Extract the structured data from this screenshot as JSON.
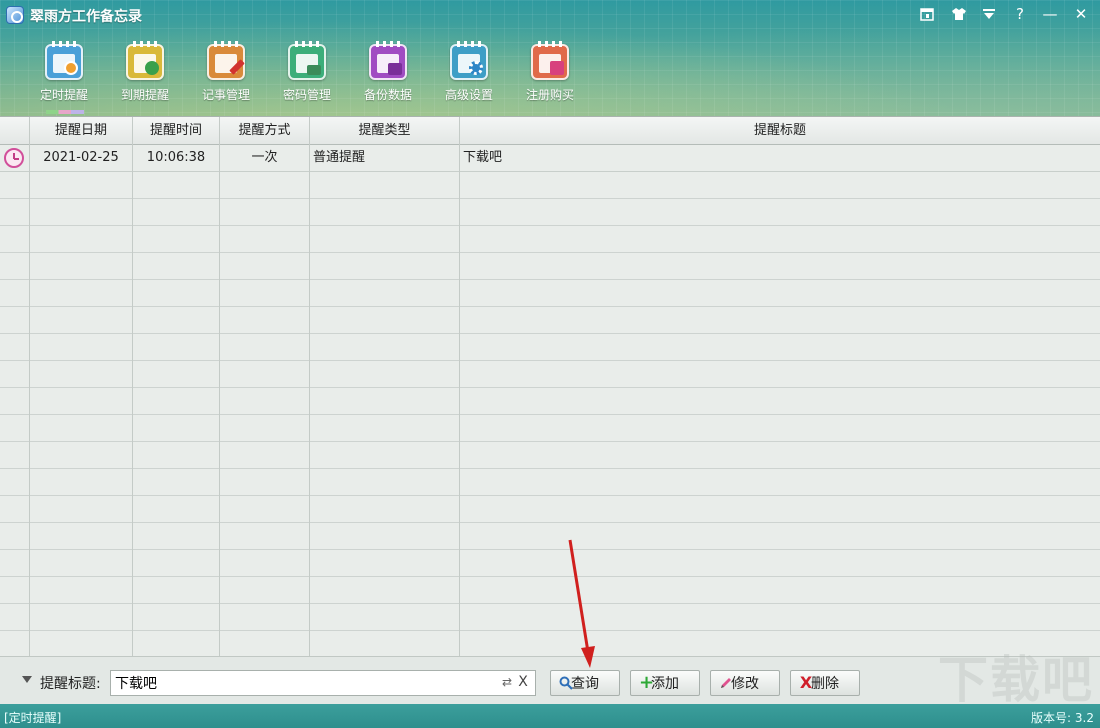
{
  "window": {
    "title": "翠雨方工作备忘录",
    "controls": [
      "calendar-icon",
      "skin-icon",
      "menu-icon",
      "help-icon",
      "minimize-icon",
      "close-icon"
    ],
    "help_label": "?",
    "minimize_label": "—",
    "close_label": "✕"
  },
  "toolbar": {
    "items": [
      {
        "label": "定时提醒",
        "icon": "timer-reminder-icon",
        "color": "#4aa0d8"
      },
      {
        "label": "到期提醒",
        "icon": "due-reminder-icon",
        "color": "#d9b93a"
      },
      {
        "label": "记事管理",
        "icon": "notes-icon",
        "color": "#d98a3a"
      },
      {
        "label": "密码管理",
        "icon": "password-icon",
        "color": "#3cae7a"
      },
      {
        "label": "备份数据",
        "icon": "backup-icon",
        "color": "#a04cc2"
      },
      {
        "label": "高级设置",
        "icon": "settings-icon",
        "color": "#3e9ec6"
      },
      {
        "label": "注册购买",
        "icon": "register-icon",
        "color": "#e06a4a"
      }
    ],
    "active_index": 0
  },
  "table": {
    "columns": [
      "提醒日期",
      "提醒时间",
      "提醒方式",
      "提醒类型",
      "提醒标题"
    ],
    "rows": [
      {
        "date": "2021-02-25",
        "time": "10:06:38",
        "mode": "一次",
        "type": "普通提醒",
        "title": "下载吧"
      }
    ]
  },
  "search": {
    "label": "提醒标题:",
    "value": "下载吧",
    "refresh_glyph": "⇄",
    "clear_glyph": "X"
  },
  "buttons": {
    "query": "查询",
    "add": "添加",
    "edit": "修改",
    "delete": "删除"
  },
  "status": {
    "left": "[定时提醒]",
    "right": "版本号: 3.2"
  },
  "watermark": "下载吧",
  "colors": {
    "accent": "#2e8f8d",
    "annotation_arrow": "#d0201e"
  }
}
